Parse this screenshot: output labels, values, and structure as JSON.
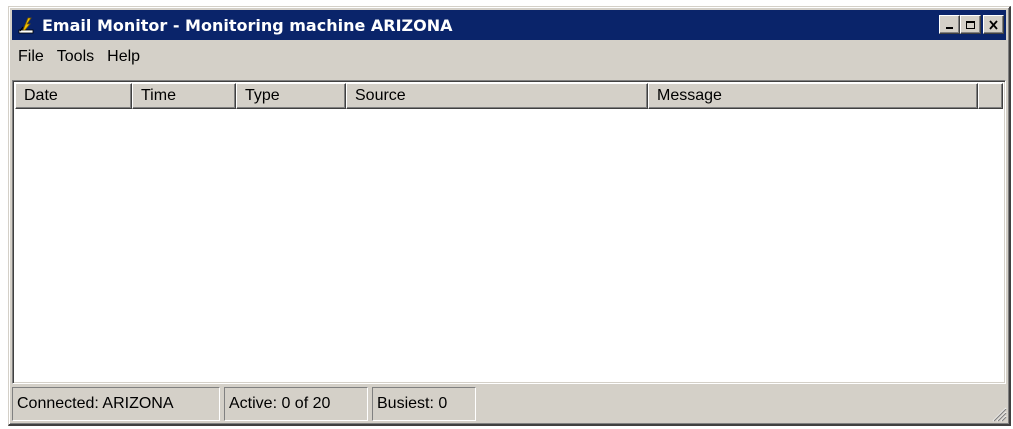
{
  "window": {
    "title": "Email Monitor - Monitoring machine ARIZONA",
    "title_bar_color": "#0a246a",
    "chrome_color": "#d4d0c8",
    "icons": {
      "app": "email-monitor-app-icon",
      "minimize": "minimize-icon",
      "maximize": "maximize-icon",
      "close": "close-icon"
    }
  },
  "menu": {
    "items": [
      {
        "label": "File"
      },
      {
        "label": "Tools"
      },
      {
        "label": "Help"
      }
    ]
  },
  "list": {
    "columns": [
      {
        "label": "Date"
      },
      {
        "label": "Time"
      },
      {
        "label": "Type"
      },
      {
        "label": "Source"
      },
      {
        "label": "Message"
      },
      {
        "label": ""
      }
    ],
    "rows": []
  },
  "status": {
    "connected": "Connected: ARIZONA",
    "active": "Active: 0 of 20",
    "busiest": "Busiest: 0"
  }
}
